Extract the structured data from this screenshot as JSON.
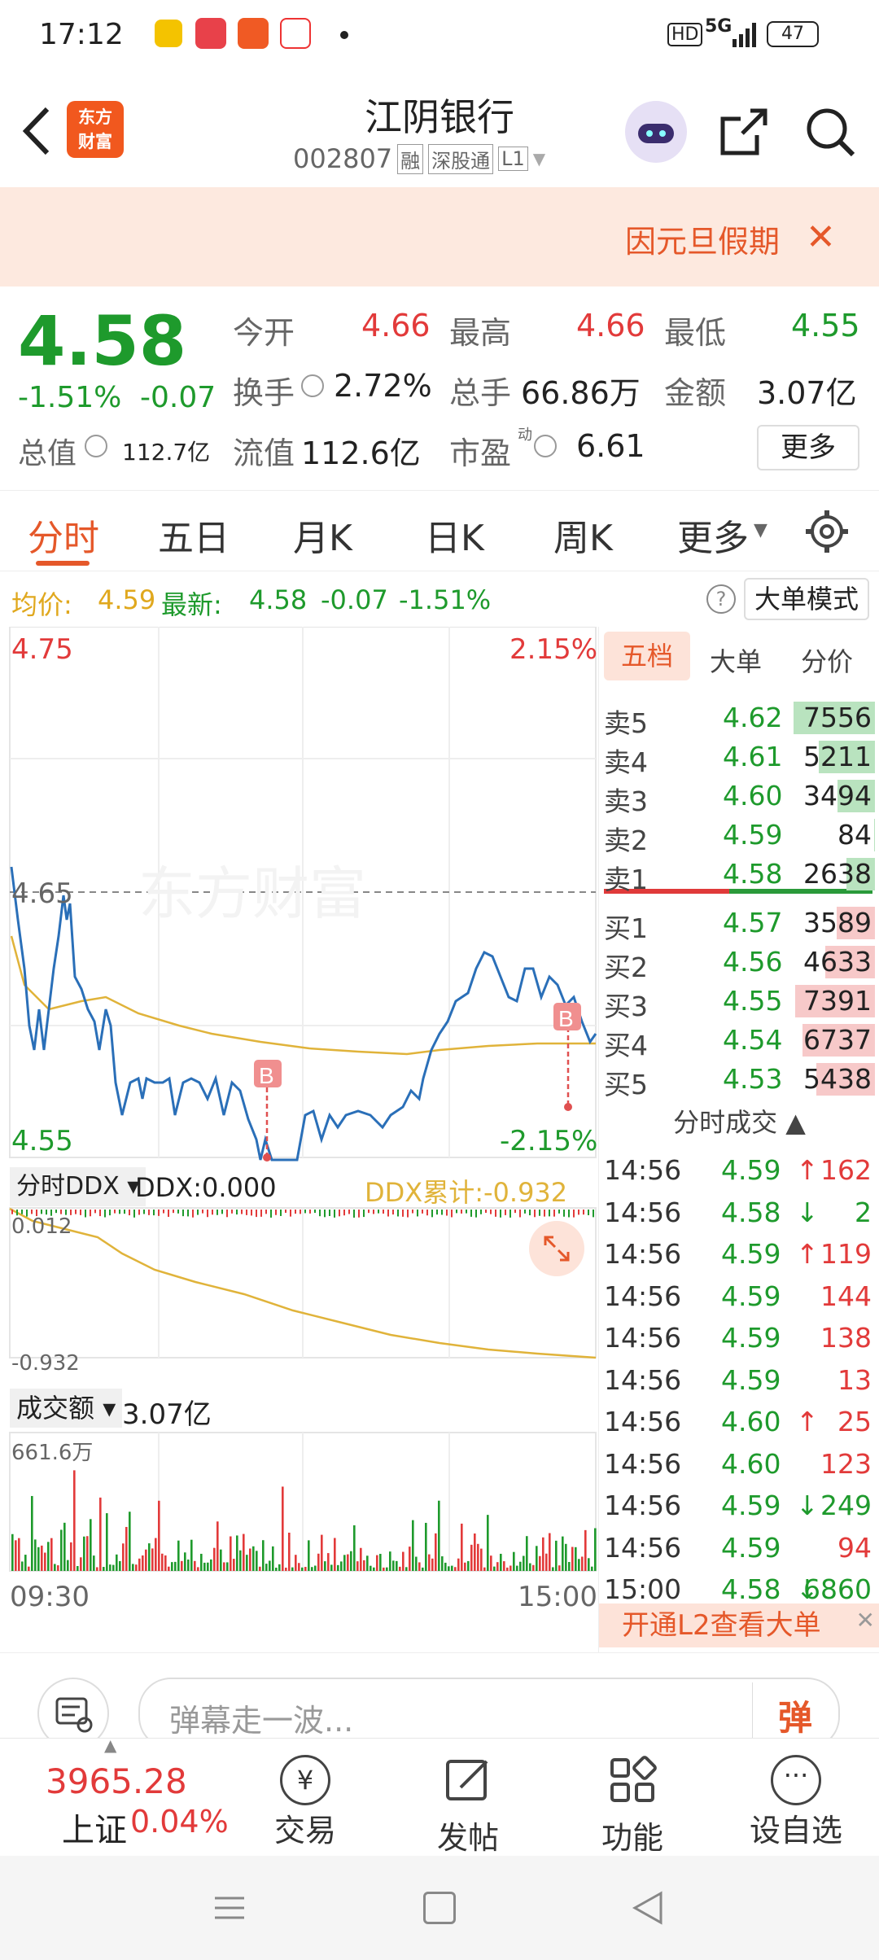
{
  "status": {
    "time": "17:12",
    "battery": "47",
    "network": "5G",
    "hd": "HD"
  },
  "header": {
    "title": "江阴银行",
    "code": "002807",
    "tags": [
      "融",
      "深股通",
      "L1"
    ],
    "logo_line1": "东方",
    "logo_line2": "财富"
  },
  "banner": {
    "text": "因元旦假期"
  },
  "quote": {
    "price": "4.58",
    "change_pct": "-1.51%",
    "change": "-0.07",
    "open_label": "今开",
    "open": "4.66",
    "high_label": "最高",
    "high": "4.66",
    "low_label": "最低",
    "low": "4.55",
    "turnover_label": "换手",
    "turnover": "2.72%",
    "volume_label": "总手",
    "volume": "66.86万",
    "amount_label": "金额",
    "amount": "3.07亿",
    "mktcap_label": "总值",
    "mktcap": "112.7亿",
    "float_label": "流值",
    "float": "112.6亿",
    "pe_label": "市盈",
    "pe_sup": "动",
    "pe": "6.61",
    "more": "更多"
  },
  "tabs": [
    "分时",
    "五日",
    "月K",
    "日K",
    "周K",
    "更多"
  ],
  "info": {
    "avg_label": "均价:",
    "avg": "4.59",
    "latest_label": "最新:",
    "latest": "4.58",
    "chg": "-0.07",
    "pct": "-1.51%",
    "mode": "大单模式"
  },
  "chart": {
    "top_price": "4.75",
    "top_pct": "2.15%",
    "mid_price": "4.65",
    "bottom_price": "4.55",
    "bottom_pct": "-2.15%",
    "watermark": "东方财富",
    "marker": "B",
    "ddx_selector": "分时DDX",
    "ddx_value": "DDX:0.000",
    "ddx_cum": "DDX累计:-0.932",
    "ddx_top": "0.012",
    "ddx_bottom": "-0.932",
    "vol_selector": "成交额",
    "vol_value": "3.07亿",
    "vol_max": "661.6万",
    "time_start": "09:30",
    "time_end": "15:00"
  },
  "side_tabs": [
    "五档",
    "大单",
    "分价"
  ],
  "asks": [
    {
      "label": "卖5",
      "price": "4.62",
      "vol": "7556"
    },
    {
      "label": "卖4",
      "price": "4.61",
      "vol": "5211"
    },
    {
      "label": "卖3",
      "price": "4.60",
      "vol": "3494"
    },
    {
      "label": "卖2",
      "price": "4.59",
      "vol": "84"
    },
    {
      "label": "卖1",
      "price": "4.58",
      "vol": "2638"
    }
  ],
  "bids": [
    {
      "label": "买1",
      "price": "4.57",
      "vol": "3589"
    },
    {
      "label": "买2",
      "price": "4.56",
      "vol": "4633"
    },
    {
      "label": "买3",
      "price": "4.55",
      "vol": "7391"
    },
    {
      "label": "买4",
      "price": "4.54",
      "vol": "6737"
    },
    {
      "label": "买5",
      "price": "4.53",
      "vol": "5438"
    }
  ],
  "ticks_title": "分时成交",
  "ticks": [
    {
      "t": "14:56",
      "p": "4.59",
      "d": "↑",
      "v": "162"
    },
    {
      "t": "14:56",
      "p": "4.58",
      "d": "↓",
      "v": "2"
    },
    {
      "t": "14:56",
      "p": "4.59",
      "d": "↑",
      "v": "119"
    },
    {
      "t": "14:56",
      "p": "4.59",
      "d": "",
      "v": "144"
    },
    {
      "t": "14:56",
      "p": "4.59",
      "d": "",
      "v": "138"
    },
    {
      "t": "14:56",
      "p": "4.59",
      "d": "",
      "v": "13"
    },
    {
      "t": "14:56",
      "p": "4.60",
      "d": "↑",
      "v": "25"
    },
    {
      "t": "14:56",
      "p": "4.60",
      "d": "",
      "v": "123"
    },
    {
      "t": "14:56",
      "p": "4.59",
      "d": "↓",
      "v": "249"
    },
    {
      "t": "14:56",
      "p": "4.59",
      "d": "",
      "v": "94"
    },
    {
      "t": "15:00",
      "p": "4.58",
      "d": "↓",
      "v": "6860"
    }
  ],
  "l2_promo": "开通L2查看大单",
  "comment": {
    "placeholder": "弹幕走一波...",
    "btn": "弹"
  },
  "nav": {
    "index_value": "3965.28",
    "index_name": "上证",
    "index_pct": "0.04%",
    "items": [
      "交易",
      "发帖",
      "功能",
      "设自选"
    ]
  }
}
